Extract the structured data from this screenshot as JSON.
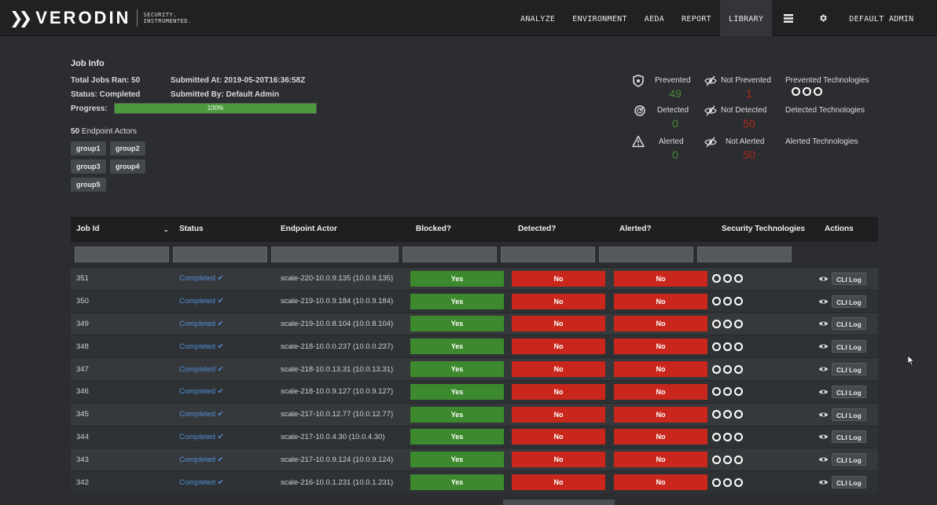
{
  "brand": {
    "name": "VERODIN",
    "tagline_1": "SECURITY.",
    "tagline_2": "INSTRUMENTED."
  },
  "nav": {
    "items": [
      "ANALYZE",
      "ENVIRONMENT",
      "AEDA",
      "REPORT",
      "LIBRARY"
    ],
    "active": "LIBRARY",
    "user": "DEFAULT ADMIN"
  },
  "job_info": {
    "title": "Job Info",
    "total_jobs": "Total Jobs Ran: 50",
    "submitted_at": "Submitted At: 2019-05-20T16:36:58Z",
    "status": "Status: Completed",
    "submitted_by": "Submitted By: Default Admin",
    "progress_label": "Progress:",
    "progress_text": "100%",
    "progress_value": 100,
    "actors_count": "50",
    "actors_label": " Endpoint Actors",
    "groups": [
      "group1",
      "group2",
      "group3",
      "group4",
      "group5"
    ]
  },
  "stats": {
    "prevented_label": "Prevented",
    "prevented": "49",
    "not_prevented_label": "Not Prevented",
    "not_prevented": "1",
    "prevented_tech_label": "Prevented Technologies",
    "detected_label": "Detected",
    "detected": "0",
    "not_detected_label": "Not Detected",
    "not_detected": "50",
    "detected_tech_label": "Detected Technologies",
    "alerted_label": "Alerted",
    "alerted": "0",
    "not_alerted_label": "Not Alerted",
    "not_alerted": "50",
    "alerted_tech_label": "Alerted Technologies"
  },
  "table": {
    "headers": [
      "Job Id",
      "Status",
      "Endpoint Actor",
      "Blocked?",
      "Detected?",
      "Alerted?",
      "Security Technologies",
      "Actions"
    ],
    "cli_label": "CLI Log",
    "rows": [
      {
        "id": "351",
        "status": "Completed ✔",
        "actor": "scale-220-10.0.9.135 (10.0.9.135)",
        "blocked": "Yes",
        "detected": "No",
        "alerted": "No"
      },
      {
        "id": "350",
        "status": "Completed ✔",
        "actor": "scale-219-10.0.9.184 (10.0.9.184)",
        "blocked": "Yes",
        "detected": "No",
        "alerted": "No"
      },
      {
        "id": "349",
        "status": "Completed ✔",
        "actor": "scale-219-10.0.8.104 (10.0.8.104)",
        "blocked": "Yes",
        "detected": "No",
        "alerted": "No"
      },
      {
        "id": "348",
        "status": "Completed ✔",
        "actor": "scale-218-10.0.0.237 (10.0.0.237)",
        "blocked": "Yes",
        "detected": "No",
        "alerted": "No"
      },
      {
        "id": "347",
        "status": "Completed ✔",
        "actor": "scale-218-10.0.13.31 (10.0.13.31)",
        "blocked": "Yes",
        "detected": "No",
        "alerted": "No"
      },
      {
        "id": "346",
        "status": "Completed ✔",
        "actor": "scale-218-10.0.9.127 (10.0.9.127)",
        "blocked": "Yes",
        "detected": "No",
        "alerted": "No"
      },
      {
        "id": "345",
        "status": "Completed ✔",
        "actor": "scale-217-10.0.12.77 (10.0.12.77)",
        "blocked": "Yes",
        "detected": "No",
        "alerted": "No"
      },
      {
        "id": "344",
        "status": "Completed ✔",
        "actor": "scale-217-10.0.4.30 (10.0.4.30)",
        "blocked": "Yes",
        "detected": "No",
        "alerted": "No"
      },
      {
        "id": "343",
        "status": "Completed ✔",
        "actor": "scale-217-10.0.9.124 (10.0.9.124)",
        "blocked": "Yes",
        "detected": "No",
        "alerted": "No"
      },
      {
        "id": "342",
        "status": "Completed ✔",
        "actor": "scale-216-10.0.1.231 (10.0.1.231)",
        "blocked": "Yes",
        "detected": "No",
        "alerted": "No"
      }
    ]
  },
  "colors": {
    "yes": "#3d8a2e",
    "no": "#c9271c",
    "link": "#4f8fd6",
    "progress": "#4c9a3c"
  }
}
